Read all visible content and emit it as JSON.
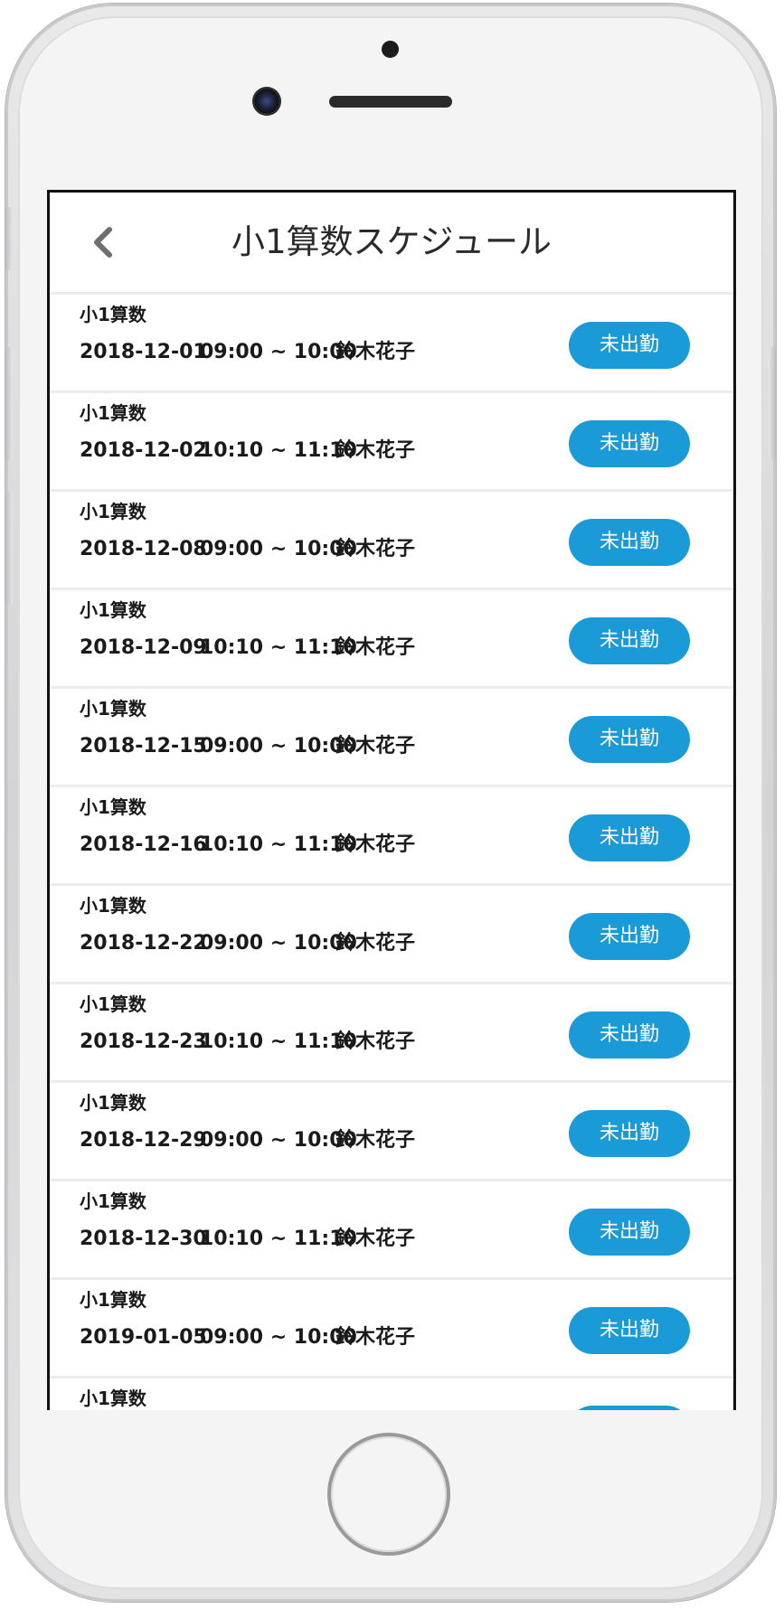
{
  "header": {
    "title": "小1算数スケジュール"
  },
  "status_button_color": "#1b9ad8",
  "schedule": [
    {
      "subject": "小1算数",
      "date": "2018-12-01",
      "time": "09:00 ~ 10:00",
      "teacher": "鈴木花子",
      "status": "未出勤"
    },
    {
      "subject": "小1算数",
      "date": "2018-12-02",
      "time": "10:10 ~ 11:10",
      "teacher": "鈴木花子",
      "status": "未出勤"
    },
    {
      "subject": "小1算数",
      "date": "2018-12-08",
      "time": "09:00 ~ 10:00",
      "teacher": "鈴木花子",
      "status": "未出勤"
    },
    {
      "subject": "小1算数",
      "date": "2018-12-09",
      "time": "10:10 ~ 11:10",
      "teacher": "鈴木花子",
      "status": "未出勤"
    },
    {
      "subject": "小1算数",
      "date": "2018-12-15",
      "time": "09:00 ~ 10:00",
      "teacher": "鈴木花子",
      "status": "未出勤"
    },
    {
      "subject": "小1算数",
      "date": "2018-12-16",
      "time": "10:10 ~ 11:10",
      "teacher": "鈴木花子",
      "status": "未出勤"
    },
    {
      "subject": "小1算数",
      "date": "2018-12-22",
      "time": "09:00 ~ 10:00",
      "teacher": "鈴木花子",
      "status": "未出勤"
    },
    {
      "subject": "小1算数",
      "date": "2018-12-23",
      "time": "10:10 ~ 11:10",
      "teacher": "鈴木花子",
      "status": "未出勤"
    },
    {
      "subject": "小1算数",
      "date": "2018-12-29",
      "time": "09:00 ~ 10:00",
      "teacher": "鈴木花子",
      "status": "未出勤"
    },
    {
      "subject": "小1算数",
      "date": "2018-12-30",
      "time": "10:10 ~ 11:10",
      "teacher": "鈴木花子",
      "status": "未出勤"
    },
    {
      "subject": "小1算数",
      "date": "2019-01-05",
      "time": "09:00 ~ 10:00",
      "teacher": "鈴木花子",
      "status": "未出勤"
    },
    {
      "subject": "小1算数",
      "date": "",
      "time": "",
      "teacher": "",
      "status": ""
    }
  ]
}
